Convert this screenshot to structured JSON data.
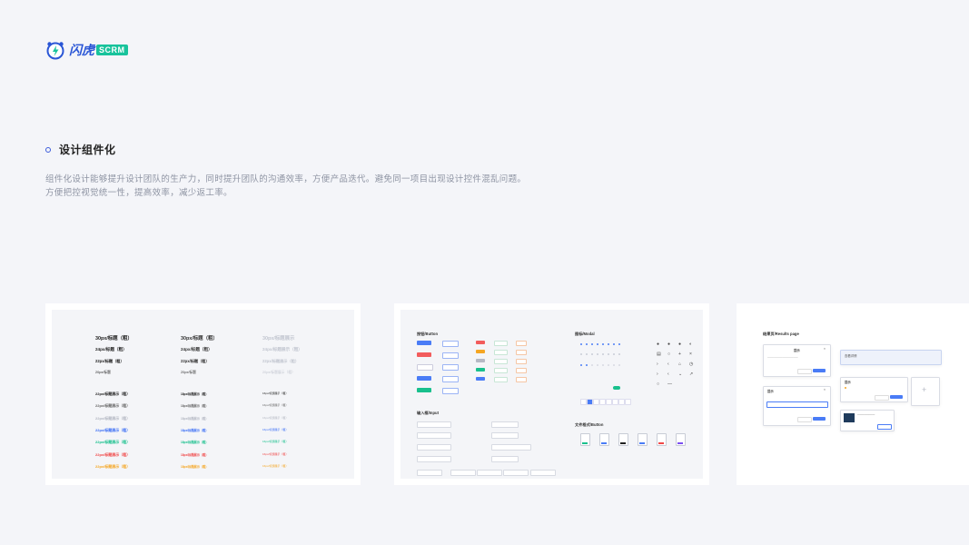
{
  "brand": {
    "name": "闪虎",
    "tag": "SCRM",
    "primary": "#2a56d6",
    "accent": "#18c39c"
  },
  "section": {
    "title": "设计组件化",
    "desc_line1": "组件化设计能够提升设计团队的生产力，同时提升团队的沟通效率，方便产品迭代。避免同一项目出现设计控件混乱问题。",
    "desc_line2": "方便把控视觉统一性，提高效率，减少返工率。"
  },
  "typography_card": {
    "col1": [
      "30px/标题（粗）",
      "24px/标题（粗）",
      "22px/标题（粗）",
      "20px/标题"
    ],
    "col2": [
      "30px/标题（粗）",
      "24px/标题（粗）",
      "22px/标题（粗）",
      "20px/标题"
    ],
    "col3": [
      "30px/标题展示",
      "24px/标题展示（粗）",
      "22px/标题展示（粗）",
      "20px/标题展示（粗）"
    ],
    "color_rows": [
      {
        "text": "22px/标题展示（粗）",
        "small": "18px/标题展示（粗）",
        "tiny": "16px/标题展示（粗）",
        "color": "#222222"
      },
      {
        "text": "22px/标题展示（粗）",
        "small": "18px/标题展示（粗）",
        "tiny": "16px/标题展示（粗）",
        "color": "#666666"
      },
      {
        "text": "22px/标题展示（粗）",
        "small": "18px/标题展示（粗）",
        "tiny": "16px/标题展示（粗）",
        "color": "#b3b7c2"
      },
      {
        "text": "22px/标题展示（粗）",
        "small": "18px/标题展示（粗）",
        "tiny": "16px/标题展示（粗）",
        "color": "#3b6ef5"
      },
      {
        "text": "22px/标题展示（粗）",
        "small": "18px/标题展示（粗）",
        "tiny": "16px/标题展示（粗）",
        "color": "#19c08d"
      },
      {
        "text": "22px/标题展示（粗）",
        "small": "18px/标题展示（粗）",
        "tiny": "16px/标题展示（粗）",
        "color": "#f04848"
      },
      {
        "text": "22px/标题展示（粗）",
        "small": "18px/标题展示（粗）",
        "tiny": "16px/标题展示（粗）",
        "color": "#f5a623"
      }
    ]
  },
  "component_card": {
    "button_label": "按钮/Button",
    "input_label": "输入框/Input",
    "modal_label": "图标/Modal",
    "file_label": "文件格式/Button",
    "btn_colors": [
      "#4a7cf6",
      "#f25c5c",
      "#4a7cf6",
      "#19c08d"
    ],
    "file_colors": [
      "#19c08d",
      "#4a7cf6",
      "#222222",
      "#4a7cf6",
      "#f04848",
      "#7b4ff0"
    ]
  },
  "results_card": {
    "title": "结果页/Results page",
    "modal_title": "提示",
    "cancel": "取消",
    "confirm": "确定",
    "info_text": "查看详情",
    "plus": "+"
  }
}
